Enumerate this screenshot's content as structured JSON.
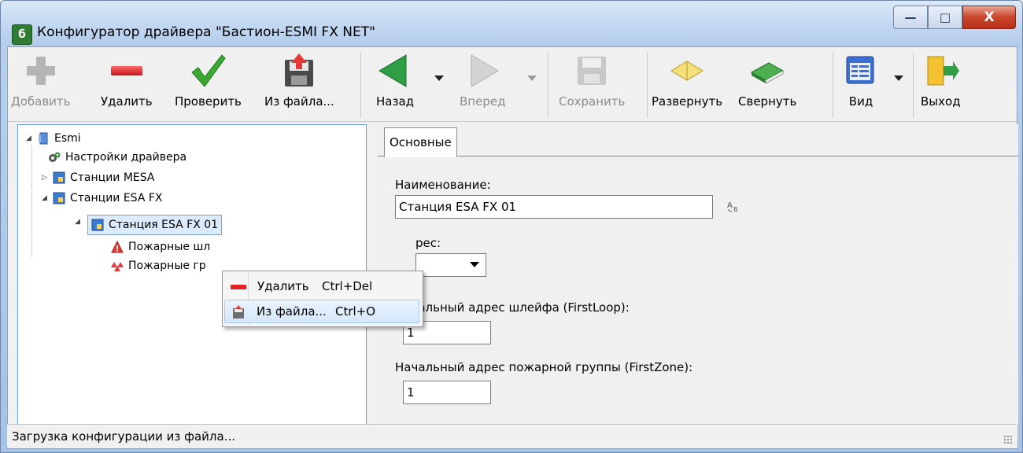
{
  "window": {
    "title": "Конфигуратор драйвера \"Бастион-ESMI FX NET\"",
    "app_icon_glyph": "б",
    "controls": {
      "minimize": "—",
      "maximize": "□",
      "close": "X"
    }
  },
  "toolbar": {
    "add": "Добавить",
    "delete": "Удалить",
    "check": "Проверить",
    "from_file": "Из файла...",
    "back": "Назад",
    "forward": "Вперед",
    "save": "Сохранить",
    "expand": "Развернуть",
    "collapse": "Свернуть",
    "view": "Вид",
    "exit": "Выход"
  },
  "tree": {
    "root": "Esmi",
    "driver_settings": "Настройки драйвера",
    "mesa": "Станции MESA",
    "esa": "Станции ESA FX",
    "station": "Станция ESA FX 01",
    "fire_loops": "Пожарные шл",
    "fire_groups": "Пожарные гр"
  },
  "context_menu": {
    "delete": "Удалить",
    "delete_shortcut": "Ctrl+Del",
    "from_file": "Из файла...",
    "from_file_shortcut": "Ctrl+O"
  },
  "panel": {
    "tab": "Основные",
    "name_label": "Наименование:",
    "name_value": "Станция ESA FX 01",
    "address_label": "рес:",
    "first_loop_label": "Начальный адрес шлейфа (FirstLoop):",
    "first_loop_value": "1",
    "first_zone_label": "Начальный адрес пожарной группы (FirstZone):",
    "first_zone_value": "1"
  },
  "statusbar": {
    "text": "Загрузка конфигурации из файла..."
  },
  "colors": {
    "accent": "#3399ff",
    "delete_red": "#e8262b",
    "check_green": "#3aa932",
    "back_green": "#2f9e44"
  }
}
